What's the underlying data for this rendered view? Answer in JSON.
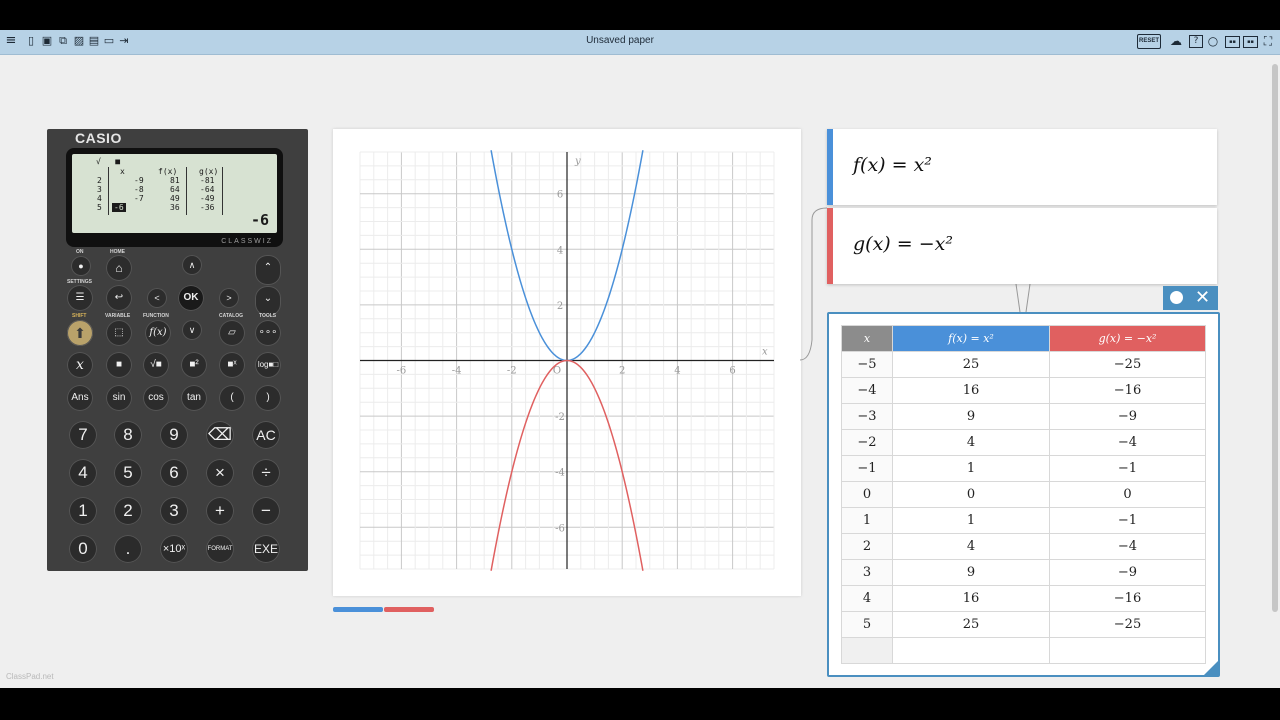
{
  "toolbar": {
    "title": "Unsaved paper",
    "reset_label": "RESET",
    "left_icons": [
      "menu-icon",
      "new-file-icon",
      "save-icon",
      "copy-icon",
      "image-icon",
      "open-icon",
      "export-icon",
      "exit-icon"
    ],
    "right_icons": [
      "cloud-upload-icon",
      "help-icon",
      "circle-icon",
      "badge-icon",
      "badge-icon",
      "fullscreen-icon"
    ]
  },
  "footer": {
    "logo_text": "ClassPad.net"
  },
  "calculator": {
    "brand": "CASIO",
    "model": "CLASSWIZ",
    "screen": {
      "header_icons": [
        "√",
        "■"
      ],
      "col_headers": [
        "x",
        "f(x)",
        "g(x)"
      ],
      "rows": [
        {
          "n": "2",
          "x": "-9",
          "f": "81",
          "g": "-81"
        },
        {
          "n": "3",
          "x": "-8",
          "f": "64",
          "g": "-64"
        },
        {
          "n": "4",
          "x": "-7",
          "f": "49",
          "g": "-49"
        },
        {
          "n": "5",
          "x": "-6",
          "f": "36",
          "g": "-36"
        }
      ],
      "result": "-6"
    },
    "labels": {
      "on": "ON",
      "home": "HOME",
      "settings": "SETTINGS",
      "shift": "SHIFT",
      "variable": "VARIABLE",
      "function": "FUNCTION",
      "catalog": "CATALOG",
      "tools": "TOOLS",
      "ok": "OK"
    },
    "func_keys_row1": [
      "x",
      "■",
      "√■",
      "■²",
      "■ˣ",
      "log■□"
    ],
    "func_keys_row2": [
      "Ans",
      "sin",
      "cos",
      "tan",
      "(",
      ")"
    ],
    "num_rows": [
      [
        "7",
        "8",
        "9",
        "⌫",
        "AC"
      ],
      [
        "4",
        "5",
        "6",
        "×",
        "÷"
      ],
      [
        "1",
        "2",
        "3",
        "+",
        "−"
      ],
      [
        "0",
        ".",
        "×10ˣ",
        "FORMAT",
        "EXE"
      ]
    ]
  },
  "graph": {
    "x_label": "x",
    "y_label": "y",
    "x_ticks": [
      "-6",
      "-4",
      "-2",
      "O",
      "2",
      "4",
      "6"
    ],
    "y_ticks": [
      "6",
      "4",
      "2",
      "-2",
      "-4",
      "-6"
    ],
    "f_color": "#4a90d9",
    "g_color": "#e06060"
  },
  "expressions": [
    {
      "name": "f",
      "text": "f(x) = x²",
      "color": "#4a90d9"
    },
    {
      "name": "g",
      "text": "g(x) = −x²",
      "color": "#e06060"
    }
  ],
  "value_table": {
    "headers": [
      "x",
      "f(x) = x²",
      "g(x) = −x²"
    ],
    "header_colors": [
      "#888888",
      "#4a90d9",
      "#e06060"
    ],
    "rows": [
      [
        "−5",
        "25",
        "−25"
      ],
      [
        "−4",
        "16",
        "−16"
      ],
      [
        "−3",
        "9",
        "−9"
      ],
      [
        "−2",
        "4",
        "−4"
      ],
      [
        "−1",
        "1",
        "−1"
      ],
      [
        "0",
        "0",
        "0"
      ],
      [
        "1",
        "1",
        "−1"
      ],
      [
        "2",
        "4",
        "−4"
      ],
      [
        "3",
        "9",
        "−9"
      ],
      [
        "4",
        "16",
        "−16"
      ],
      [
        "5",
        "25",
        "−25"
      ]
    ]
  }
}
